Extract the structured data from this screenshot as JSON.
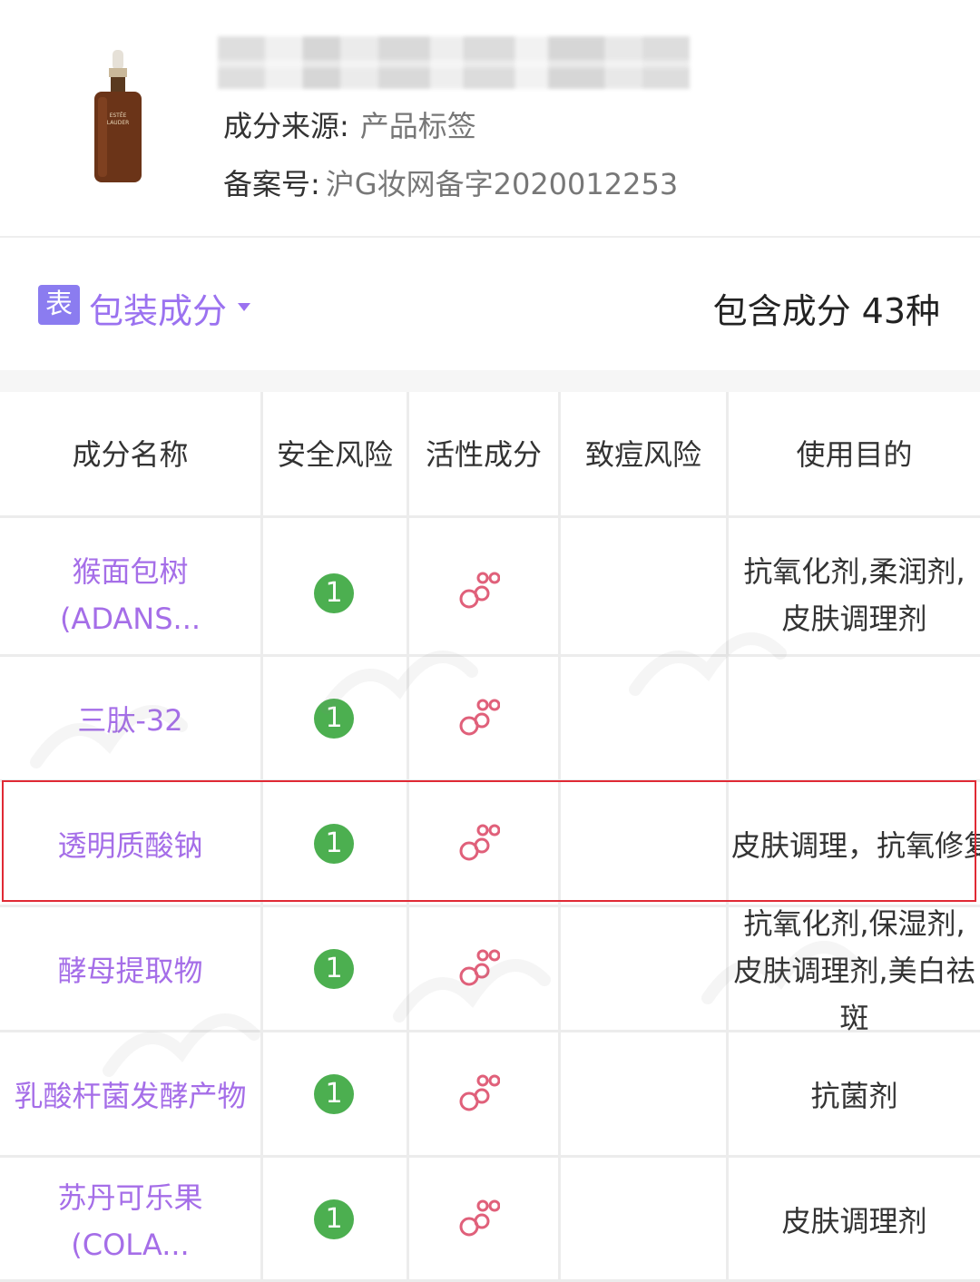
{
  "product": {
    "source_label": "成分来源:",
    "source_value": "产品标签",
    "record_label": "备案号:",
    "record_value": "沪G妆网备字2020012253"
  },
  "section": {
    "tag": "表",
    "title": "包装成分",
    "count_text": "包含成分 43种"
  },
  "table": {
    "headers": [
      "成分名称",
      "安全风险",
      "活性成分",
      "致痘风险",
      "使用目的"
    ],
    "rows": [
      {
        "name_lines": [
          "猴面包树",
          "(ADANS..."
        ],
        "risk": "1",
        "active": true,
        "acne": "",
        "purpose_lines": [
          "抗氧化剂,柔润剂,",
          "皮肤调理剂"
        ]
      },
      {
        "name_lines": [
          "三肽-32"
        ],
        "risk": "1",
        "active": true,
        "acne": "",
        "purpose_lines": []
      },
      {
        "name_lines": [
          "透明质酸钠"
        ],
        "risk": "1",
        "active": true,
        "acne": "",
        "purpose_lines": [
          "皮肤调理，抗氧修复"
        ]
      },
      {
        "name_lines": [
          "酵母提取物"
        ],
        "risk": "1",
        "active": true,
        "acne": "",
        "purpose_lines": [
          "抗氧化剂,保湿剂,",
          "皮肤调理剂,美白祛",
          "斑"
        ]
      },
      {
        "name_lines": [
          "乳酸杆菌发酵产物"
        ],
        "risk": "1",
        "active": true,
        "acne": "",
        "purpose_lines": [
          "抗菌剂"
        ]
      },
      {
        "name_lines": [
          "苏丹可乐果",
          "(COLA..."
        ],
        "risk": "1",
        "active": true,
        "acne": "",
        "purpose_lines": [
          "皮肤调理剂"
        ]
      }
    ]
  },
  "colors": {
    "accent_purple": "#9b72f0",
    "risk_green": "#4caf50",
    "active_pink": "#e0607a",
    "highlight_red": "#e02a35"
  }
}
